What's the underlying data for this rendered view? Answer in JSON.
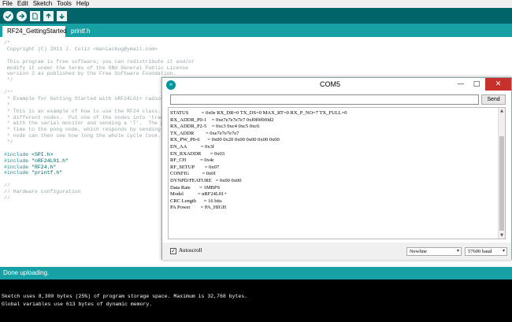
{
  "menu": [
    "File",
    "Edit",
    "Sketch",
    "Tools",
    "Help"
  ],
  "toolbar": {
    "buttons": [
      {
        "name": "verify-icon"
      },
      {
        "name": "upload-icon"
      },
      {
        "name": "new-icon"
      },
      {
        "name": "open-icon"
      },
      {
        "name": "save-icon"
      }
    ]
  },
  "tabs": [
    {
      "label": "RF24_GettingStarted"
    },
    {
      "label": "printf.h"
    }
  ],
  "editor": {
    "lines": [
      "/*",
      " Copyright (C) 2011 J. Coliz <maniacbug@ymail.com>",
      "",
      " This program is free software; you can redistribute it and/or",
      " modify it under the terms of the GNU General Public License",
      " version 2 as published by the Free Software Foundation.",
      " */",
      "",
      "/**",
      " * Example for Getting Started with nRF24L01+ radios.",
      " *",
      " * This is an example of how to use the RF24 class.  Write",
      " * different nodes.  Put one of the nodes into 'transmit' m",
      " * with the serial monitor and sending a 'T'.  The ping nod",
      " * time to the pong node, which responds by sending the val",
      " * node can then see how long the whole cycle took.",
      " */",
      "",
      "#include <SPI.h>",
      "#include \"nRF24L01.h\"",
      "#include \"RF24.h\"",
      "#include \"printf.h\"",
      "",
      "//",
      "// Hardware configuration",
      "//"
    ]
  },
  "status": {
    "text": "Done uploading."
  },
  "console": {
    "lines": [
      "Sketch uses 8,300 bytes (25%) of program storage space. Maximum is 32,768 bytes.",
      "Global variables use 613 bytes of dynamic memory."
    ]
  },
  "serial": {
    "title": "COM5",
    "send_label": "Send",
    "input_value": "",
    "output": [
      "STATUS          = 0x0e RX_DR=0 TX_DS=0 MAX_RT=0 RX_P_NO=7 TX_FULL=0",
      "RX_ADDR_P0-1    = 0xe7e7e7e7e7 0xf0f0f0f0d2",
      "RX_ADDR_P2-5    = 0xc3 0xc4 0xc5 0xc6",
      "TX_ADDR         = 0xe7e7e7e7e7",
      "RX_PW_P0-6      = 0x00 0x20 0x00 0x00 0x00 0x00",
      "EN_AA           = 0x3f",
      "EN_RXADDR       = 0x03",
      "RF_CH           = 0x4c",
      "RF_SETUP        = 0x07",
      "CONFIG          = 0x0f",
      "DYNPD/FEATURE   = 0x00 0x00",
      "Data Rate       = 1MBPS",
      "Model           = nRF24L01+",
      "CRC Length      = 16 bits",
      "PA Power        = PA_HIGH"
    ],
    "autoscroll_label": "Autoscroll",
    "autoscroll_checked": true,
    "line_ending": "Newline",
    "baud": "57600 baud"
  }
}
